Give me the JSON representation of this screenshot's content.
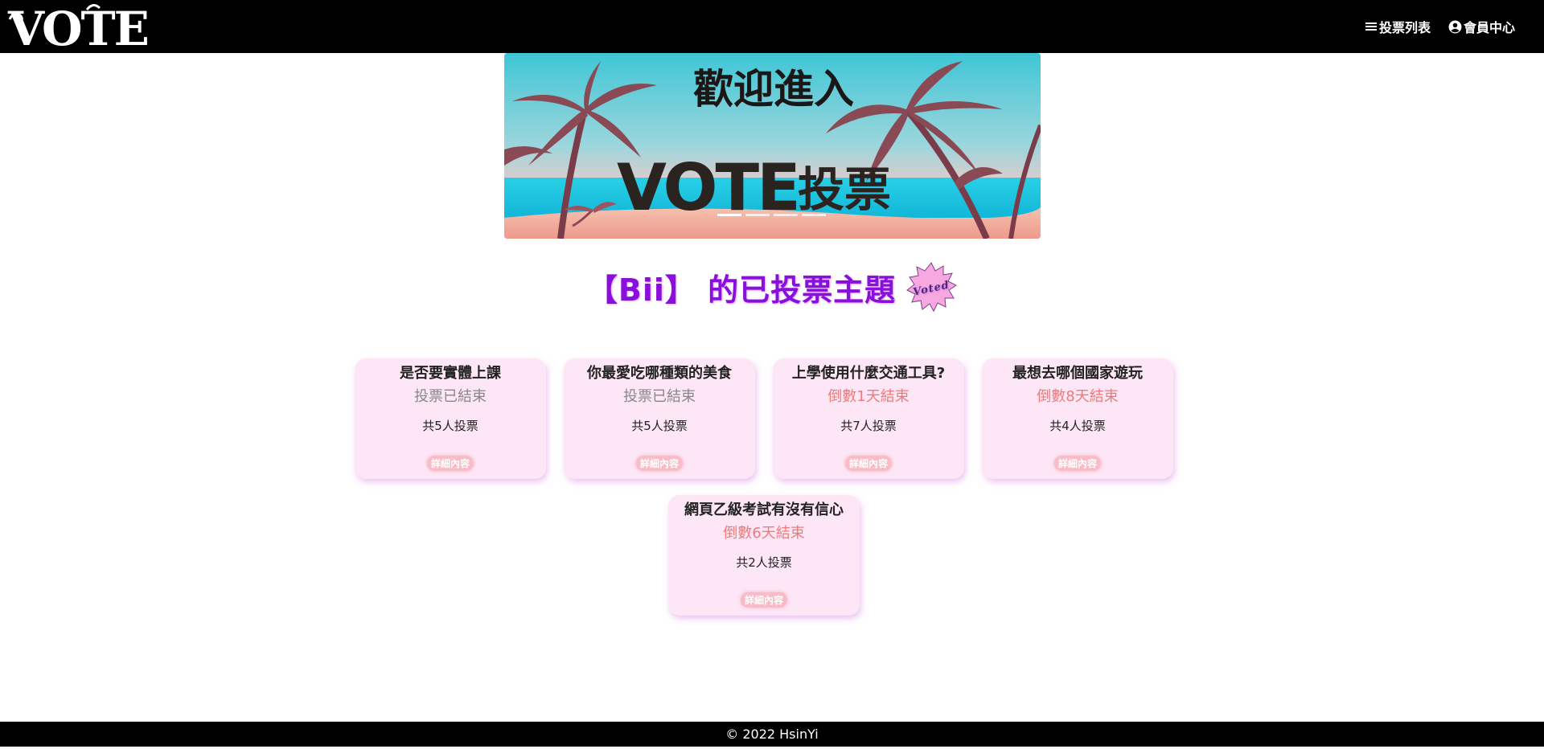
{
  "header": {
    "logo_text": "VOTE",
    "nav": [
      {
        "label": "投票列表",
        "icon": "menu-icon"
      },
      {
        "label": "會員中心",
        "icon": "user-circle-icon"
      }
    ]
  },
  "banner": {
    "line1": "歡迎進入",
    "line2_en": "VOTE",
    "line2_zh": "投票"
  },
  "heading": {
    "text": "【Bii】 的已投票主題",
    "badge_text": "Voted"
  },
  "polls": [
    {
      "title": "是否要實體上課",
      "status": "投票已結束",
      "active": false,
      "count": "共5人投票",
      "button": "詳細內容"
    },
    {
      "title": "你最愛吃哪種類的美食",
      "status": "投票已結束",
      "active": false,
      "count": "共5人投票",
      "button": "詳細內容"
    },
    {
      "title": "上學使用什麼交通工具?",
      "status": "倒數1天結束",
      "active": true,
      "count": "共7人投票",
      "button": "詳細內容"
    },
    {
      "title": "最想去哪個國家遊玩",
      "status": "倒數8天結束",
      "active": true,
      "count": "共4人投票",
      "button": "詳細內容"
    },
    {
      "title": "網頁乙級考試有沒有信心",
      "status": "倒數6天結束",
      "active": true,
      "count": "共2人投票",
      "button": "詳細內容"
    }
  ],
  "footer": {
    "text": "© 2022 HsinYi"
  },
  "colors": {
    "header_bg": "#000000",
    "heading": "#8a0fdc",
    "card_bg": "#fde6f5",
    "active_status": "#f07a7a",
    "button_bg": "#f9bcc6"
  }
}
